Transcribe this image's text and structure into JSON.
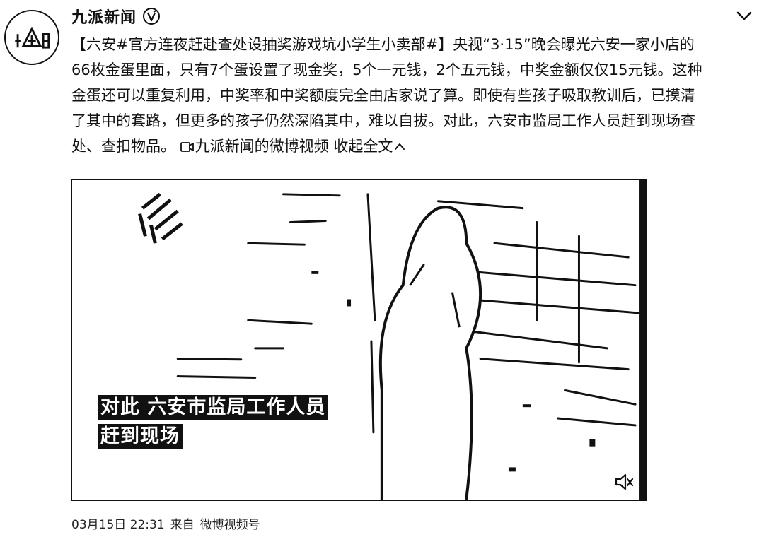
{
  "post": {
    "author": "九派新闻",
    "verified_icon": "verified-v-icon",
    "body_lines": [
      "【六安#官方连夜赶赴查处设抽奖游戏坑小学生小卖部#】央视“3·15”晚会曝光六安一家小店的",
      "66枚金蛋里面，只有7个蛋设置了现金奖，5个一元钱，2个五元钱，中奖金额仅仅15元钱。这种",
      "金蛋还可以重复利用，中奖率和中奖额度完全由店家说了算。即使有些孩子吸取教训后，已摸清",
      "了其中的套路，但更多的孩子仍然深陷其中，难以自拔。对此，六安市监局工作人员赶到现场查",
      "处、查扣物品。"
    ],
    "video_link_label": "九派新闻的微博视频",
    "collapse_label": "收起全文"
  },
  "video": {
    "caption_line1": "对此 六安市监局工作人员",
    "caption_line2": "赶到现场"
  },
  "meta": {
    "timestamp": "03月15日 22:31",
    "source_prefix": "来自",
    "source": "微博视频号"
  }
}
